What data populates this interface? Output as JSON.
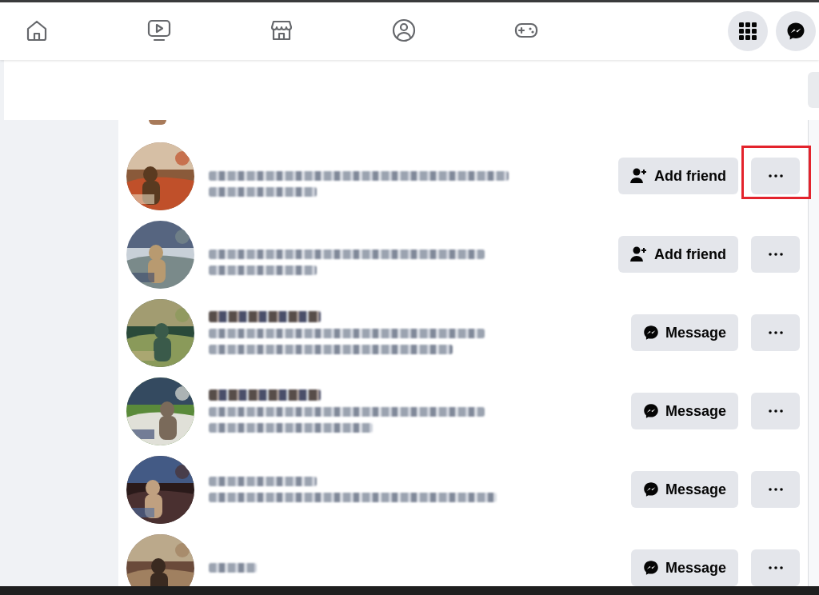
{
  "nav": {
    "tabs": [
      {
        "kind": "home",
        "selected": false
      },
      {
        "kind": "watch",
        "selected": false
      },
      {
        "kind": "marketplace",
        "selected": false
      },
      {
        "kind": "groups",
        "selected": false
      },
      {
        "kind": "gaming",
        "selected": false
      }
    ],
    "actions": [
      {
        "kind": "menu"
      },
      {
        "kind": "messenger"
      }
    ]
  },
  "rows": [
    {
      "kind": "add_friend",
      "button": "Add friend",
      "highlighted": true
    },
    {
      "kind": "add_friend",
      "button": "Add friend",
      "highlighted": false
    },
    {
      "kind": "message",
      "button": "Message",
      "highlighted": false
    },
    {
      "kind": "message",
      "button": "Message",
      "highlighted": false
    },
    {
      "kind": "message",
      "button": "Message",
      "highlighted": false
    },
    {
      "kind": "message",
      "button": "Message",
      "highlighted": false
    }
  ]
}
